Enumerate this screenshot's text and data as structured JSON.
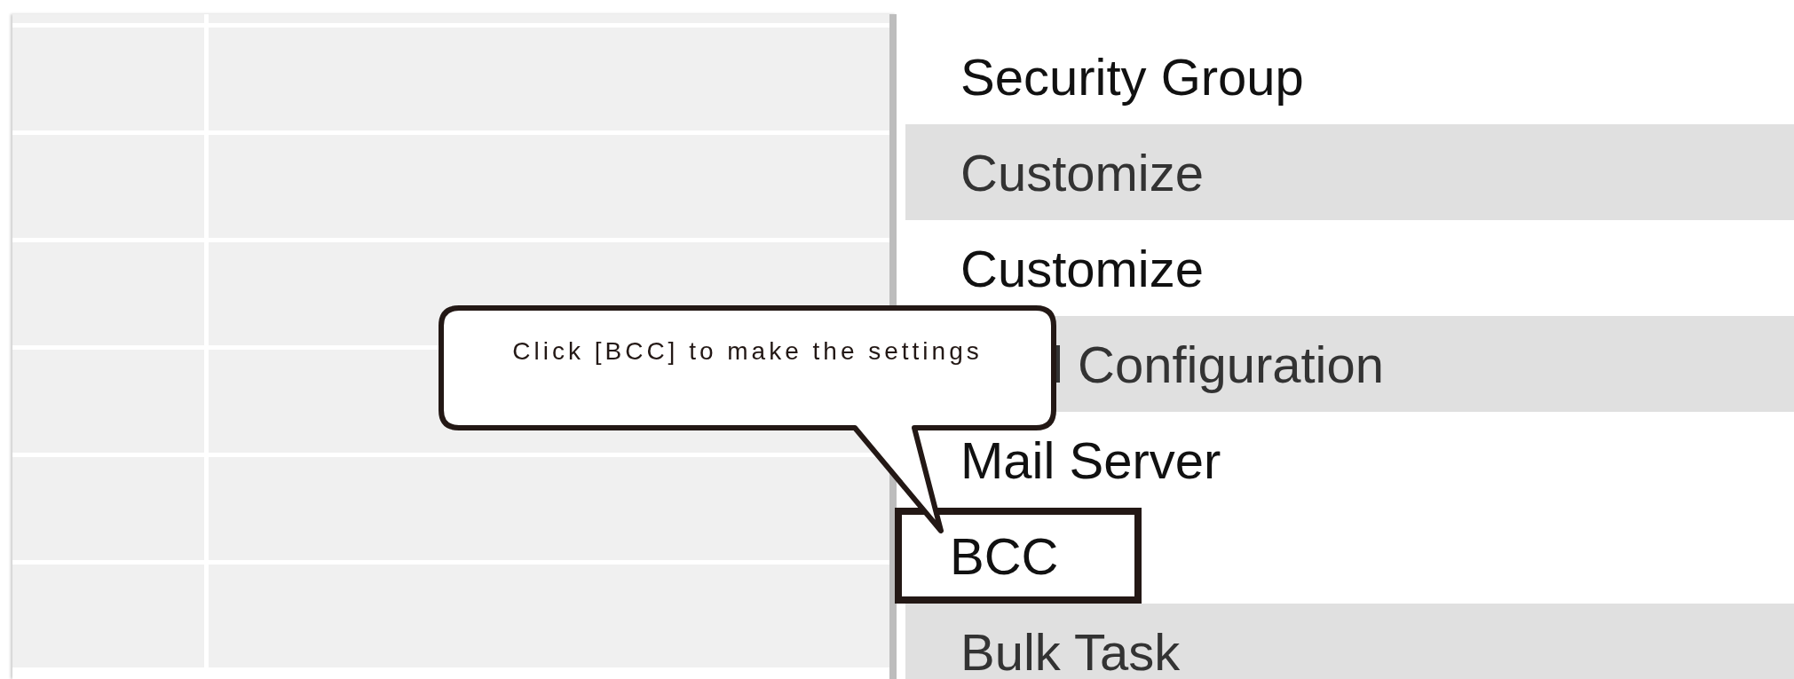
{
  "menu": [
    {
      "kind": "item",
      "label": "Security Group",
      "covered": false,
      "highlighted": false
    },
    {
      "kind": "header",
      "label": "Customize",
      "covered": false,
      "highlighted": false
    },
    {
      "kind": "item",
      "label": "Customize",
      "covered": false,
      "highlighted": false
    },
    {
      "kind": "header",
      "label": "l Configuration",
      "covered": true,
      "highlighted": false
    },
    {
      "kind": "item",
      "label": "Mail Server",
      "covered": false,
      "highlighted": false
    },
    {
      "kind": "item",
      "label": "BCC",
      "covered": false,
      "highlighted": true
    },
    {
      "kind": "header",
      "label": "Bulk Task",
      "covered": false,
      "highlighted": false
    }
  ],
  "callout": {
    "text": "Click [BCC] to make the settings"
  }
}
